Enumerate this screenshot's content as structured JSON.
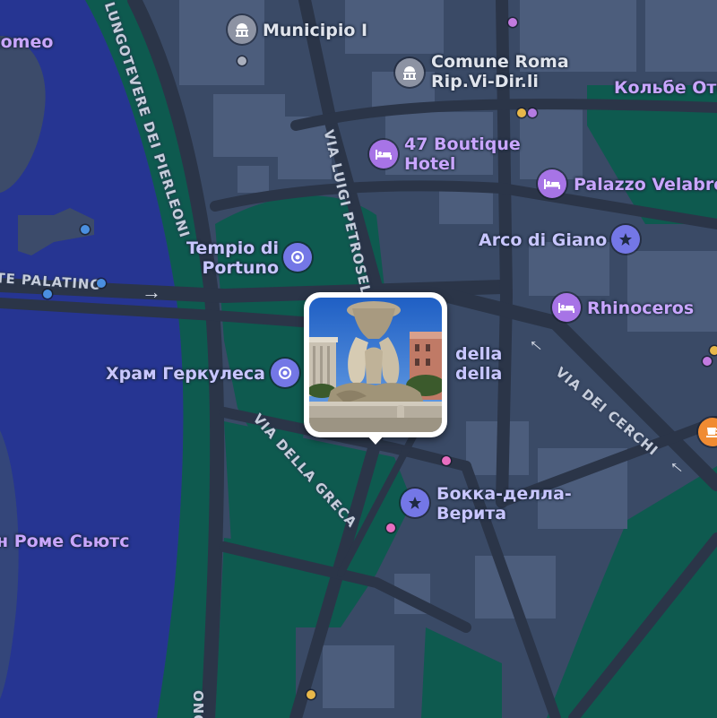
{
  "map": {
    "labels": {
      "romeo": "Romeo",
      "municipio": "Municipio I",
      "comune_line1": "Comune Roma",
      "comune_line2": "Rip.Vi-Dir.li",
      "kolbe": "Кольбе Оте",
      "boutique_line1": "47 Boutique",
      "boutique_line2": "Hotel",
      "palazzo": "Palazzo Velabro",
      "tempio_line1": "Tempio di",
      "tempio_line2": "Portuno",
      "arco": "Arco di Giano",
      "rhinoceros": "Rhinoceros",
      "khram": "Храм Геркулеса",
      "della1": "della",
      "della2": "della",
      "bokka_line1": "Бокка-делла-",
      "bokka_line2": "Верита",
      "rome_suites": "н Роме Сьютс"
    },
    "streets": {
      "lungotevere": "LUNGOTEVERE DEI PIERLEONI",
      "palatino": "TE PALATINO",
      "via_petroselli": "VIA LUIGI PETROSELLI",
      "via_cerchi": "VIA DEI CERCHI",
      "via_greca": "VIA DELLA GRECA",
      "bottom_fragment": "ONO"
    },
    "colors": {
      "river": "#263592",
      "park": "#0e5a4f",
      "block": "#3a4a66",
      "road": "#2b3548",
      "building": "#4c5d7c",
      "poi_purple": "#a774e6",
      "landmark_blue": "#7477e6",
      "government_gray": "#8d93a3"
    },
    "icons": {
      "hotel": "bed-icon",
      "government": "dome-building-icon",
      "landmark": "star-icon",
      "historic": "circle-target-icon",
      "cafe": "cup-icon"
    }
  }
}
